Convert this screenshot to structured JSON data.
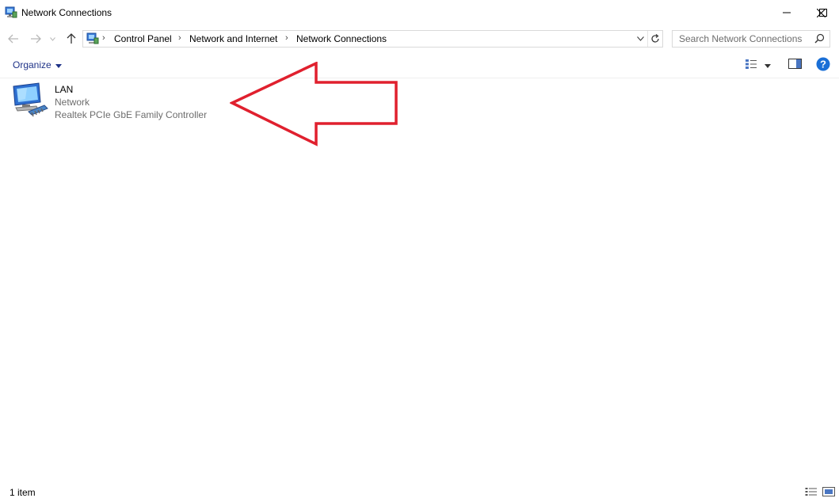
{
  "window": {
    "title": "Network Connections",
    "controls": {
      "minimize": "minimize",
      "maximize": "maximize",
      "close": "close"
    }
  },
  "address": {
    "breadcrumbs": [
      "Control Panel",
      "Network and Internet",
      "Network Connections"
    ]
  },
  "search": {
    "placeholder": "Search Network Connections"
  },
  "toolbar": {
    "organize_label": "Organize"
  },
  "connections": [
    {
      "name": "LAN",
      "status": "Network",
      "device": "Realtek PCIe GbE Family Controller"
    }
  ],
  "status": {
    "item_count": "1 item"
  },
  "colors": {
    "accent_text": "#1e3287",
    "annotation_arrow": "#e0202e",
    "help": "#1a6fd6",
    "secondary_text": "#6d6d6d"
  }
}
